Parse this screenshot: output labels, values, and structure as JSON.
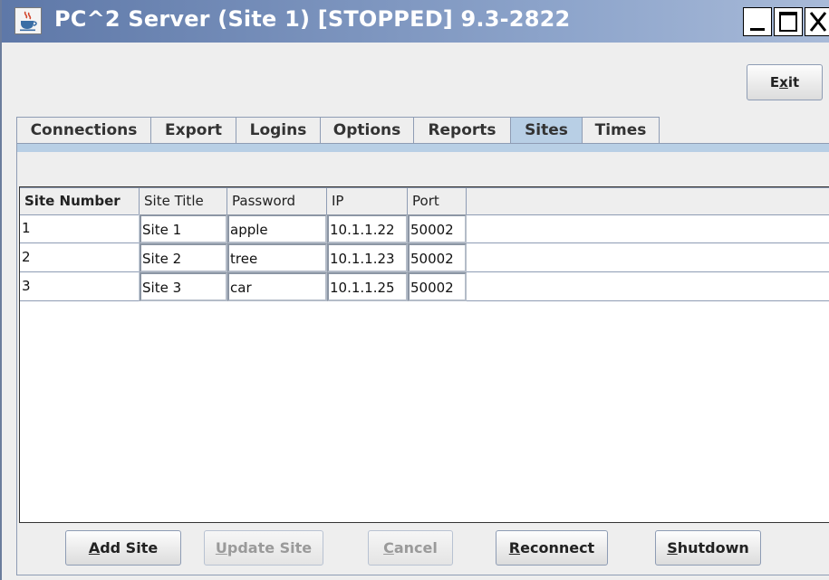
{
  "window": {
    "title": "PC^2 Server (Site 1) [STOPPED] 9.3-2822",
    "minimize_label": "_",
    "maximize_label": "□",
    "close_label": "X"
  },
  "toolbar": {
    "exit_label": "Exit"
  },
  "tabs": [
    {
      "label": "Connections",
      "active": false
    },
    {
      "label": "Export",
      "active": false
    },
    {
      "label": "Logins",
      "active": false
    },
    {
      "label": "Options",
      "active": false
    },
    {
      "label": "Reports",
      "active": false
    },
    {
      "label": "Sites",
      "active": true
    },
    {
      "label": "Times",
      "active": false
    }
  ],
  "table": {
    "columns": [
      "Site Number",
      "Site Title",
      "Password",
      "IP",
      "Port"
    ],
    "rows": [
      [
        "1",
        "Site 1",
        "apple",
        "10.1.1.22",
        "50002"
      ],
      [
        "2",
        "Site 2",
        "tree",
        "10.1.1.23",
        "50002"
      ],
      [
        "3",
        "Site 3",
        "car",
        "10.1.1.25",
        "50002"
      ]
    ]
  },
  "buttons": {
    "add_site": "Add Site",
    "update_site": "Update Site",
    "cancel": "Cancel",
    "reconnect": "Reconnect",
    "shutdown": "Shutdown"
  },
  "colors": {
    "title_gradient_start": "#5e78a8",
    "active_tab": "#b8cfe5",
    "border": "#8e9cb4"
  },
  "icons": {
    "app": "java-coffee-cup-icon"
  }
}
